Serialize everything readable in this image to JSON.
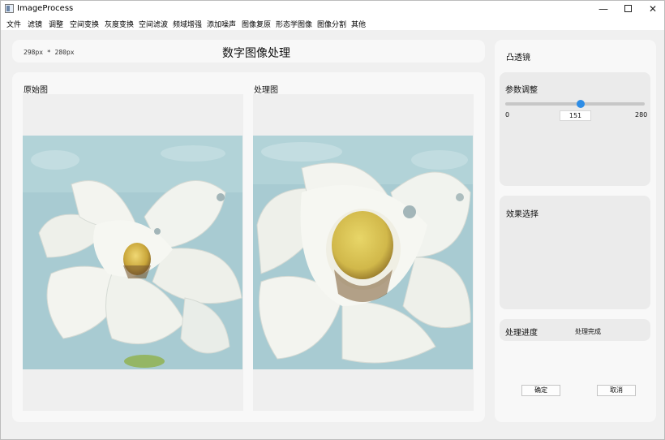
{
  "window": {
    "title": "ImageProcess",
    "controls": {
      "minimize": "—",
      "close": "✕"
    }
  },
  "menu": [
    "文件",
    "滤镜",
    "调整",
    "空间变换",
    "灰度变换",
    "空间滤波",
    "频域增强",
    "添加噪声",
    "图像复原",
    "形态学图像",
    "图像分割",
    "其他"
  ],
  "header": {
    "size_label": "298px * 280px",
    "title": "数字图像处理"
  },
  "images": {
    "original_label": "原始图",
    "processed_label": "处理图"
  },
  "side": {
    "filter_title": "凸透镜",
    "params_label": "参数调整",
    "slider": {
      "min": "0",
      "max": "280",
      "value": "151",
      "fraction": 0.539
    },
    "effect_label": "效果选择",
    "progress_label": "处理进度",
    "progress_status": "处理完成",
    "ok_button": "确定",
    "cancel_button": "取消"
  },
  "colors": {
    "accent": "#2e8de6",
    "water": "#a9ccd2",
    "petal": "#f3f4ef",
    "center_yellow": "#dcc24a"
  }
}
